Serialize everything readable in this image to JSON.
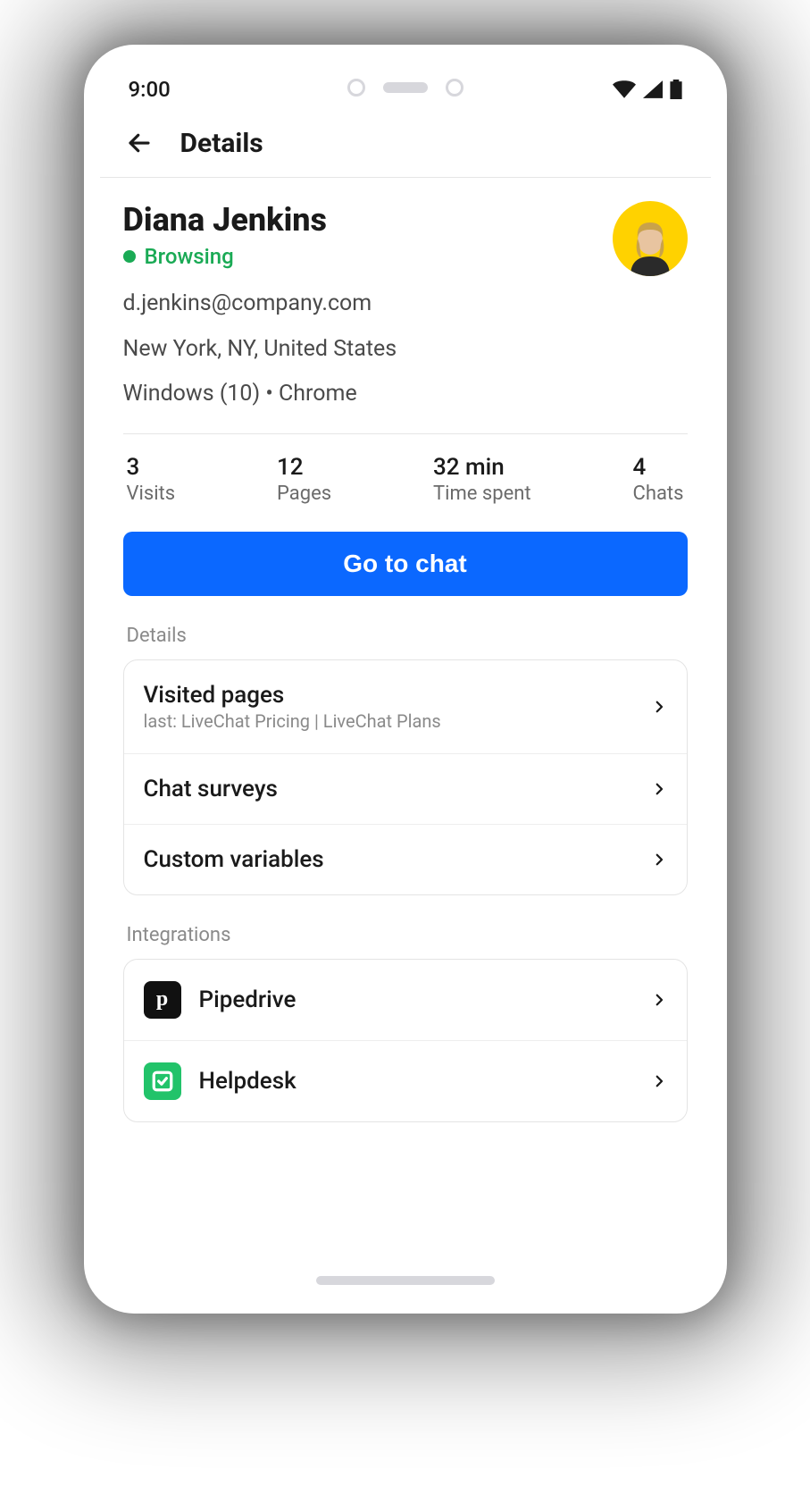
{
  "status_bar": {
    "time": "9:00"
  },
  "header": {
    "title": "Details"
  },
  "profile": {
    "name": "Diana Jenkins",
    "presence": "Browsing",
    "email": "d.jenkins@company.com",
    "location": "New York, NY, United States",
    "system": "Windows (10) • Chrome"
  },
  "stats": [
    {
      "value": "3",
      "label": "Visits"
    },
    {
      "value": "12",
      "label": "Pages"
    },
    {
      "value": "32 min",
      "label": "Time spent"
    },
    {
      "value": "4",
      "label": "Chats"
    }
  ],
  "cta": {
    "label": "Go to chat"
  },
  "sections": {
    "details": {
      "label": "Details",
      "items": [
        {
          "title": "Visited pages",
          "subtitle": "last: LiveChat Pricing | LiveChat Plans"
        },
        {
          "title": "Chat surveys"
        },
        {
          "title": "Custom variables"
        }
      ]
    },
    "integrations": {
      "label": "Integrations",
      "items": [
        {
          "title": "Pipedrive",
          "icon": "pipedrive"
        },
        {
          "title": "Helpdesk",
          "icon": "helpdesk"
        }
      ]
    }
  },
  "colors": {
    "primary": "#0b68ff",
    "success": "#1aaa55",
    "avatar_bg": "#ffd200",
    "helpdesk_bg": "#22c36a"
  }
}
